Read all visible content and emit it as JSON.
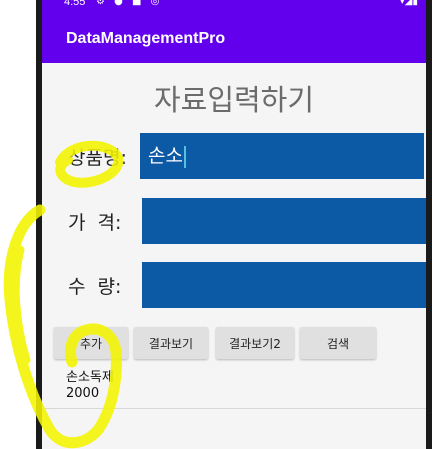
{
  "status_bar": {
    "time": "4:55",
    "icons": "⚙ ● ■ ◎",
    "right": "▾◢▮"
  },
  "app_bar": {
    "title": "DataManagementPro"
  },
  "form": {
    "heading": "자료입력하기",
    "rows": [
      {
        "label": "상품명:",
        "value": "손소",
        "placeholder": ""
      },
      {
        "label": "가  격:",
        "value": "",
        "placeholder": ""
      },
      {
        "label": "수  량:",
        "value": "",
        "placeholder": ""
      }
    ]
  },
  "buttons": {
    "add": "추가",
    "view_results": "결과보기",
    "view_results2": "결과보기2",
    "search": "검색"
  },
  "result": {
    "line1": "손소독제",
    "line2": "2000"
  },
  "colors": {
    "app_bar": "#6200ee",
    "input_bg": "#0c5aa6",
    "highlighter": "#f4f400"
  }
}
